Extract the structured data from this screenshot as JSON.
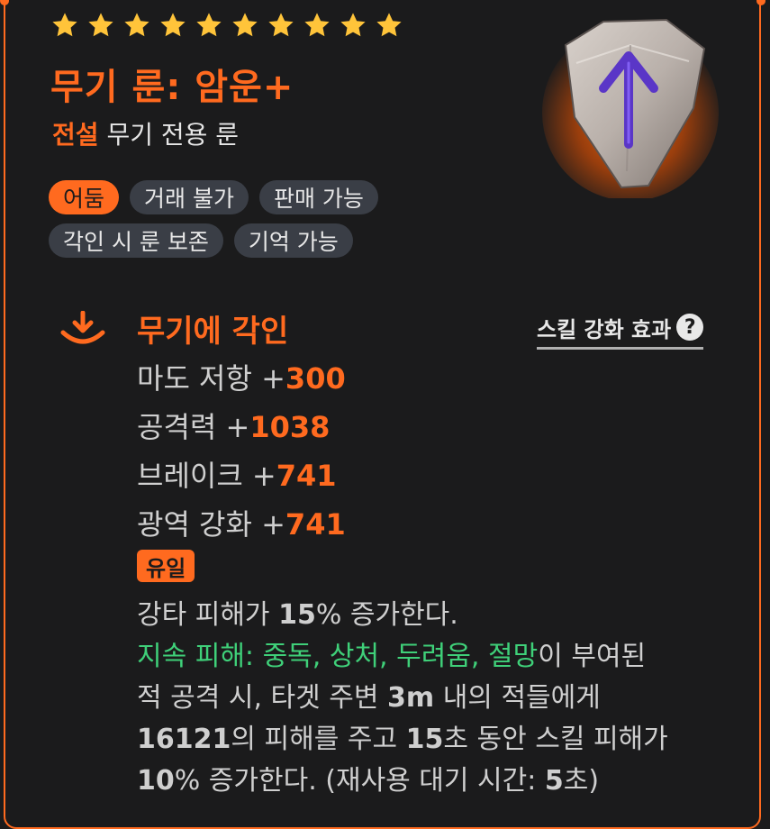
{
  "stars_count": 10,
  "item": {
    "name": "무기 룬: 암운+",
    "grade": "전설",
    "category": "무기 전용 룬"
  },
  "tags": [
    "어둠",
    "거래 불가",
    "판매 가능",
    "각인 시 룬 보존",
    "기억 가능"
  ],
  "section": {
    "title": "무기에 각인",
    "skill_link": "스킬 강화 효과",
    "help_icon": "question-mark-icon"
  },
  "stats": [
    {
      "label": "마도 저항 +",
      "value": "300"
    },
    {
      "label": "공격력 +",
      "value": "1038"
    },
    {
      "label": "브레이크 +",
      "value": "741"
    },
    {
      "label": "광역 강화 +",
      "value": "741"
    }
  ],
  "unique_badge": "유일",
  "description": {
    "l1_a": "강타 피해가 ",
    "l1_b": "15",
    "l1_c": "% 증가한다.",
    "l2_green": "지속 피해: 중독, 상처, 두려움, 절망",
    "l2_c": "이 부여된",
    "l3_a": "적 공격 시, 타겟 주변 ",
    "l3_b": "3m",
    "l3_c": " 내의 적들에게",
    "l4_a": "16121",
    "l4_b": "의 피해를 주고 ",
    "l4_c": "15",
    "l4_d": "초 동안 스킬 피해가",
    "l5_a": "10",
    "l5_b": "% 증가한다. (재사용 대기 시간: ",
    "l5_c": "5",
    "l5_d": "초)"
  },
  "colors": {
    "accent": "#ff6a1f",
    "green": "#3fd079",
    "star": "#ffc43a",
    "background": "#1b1b1c",
    "tag_bg": "#3a3e46"
  }
}
